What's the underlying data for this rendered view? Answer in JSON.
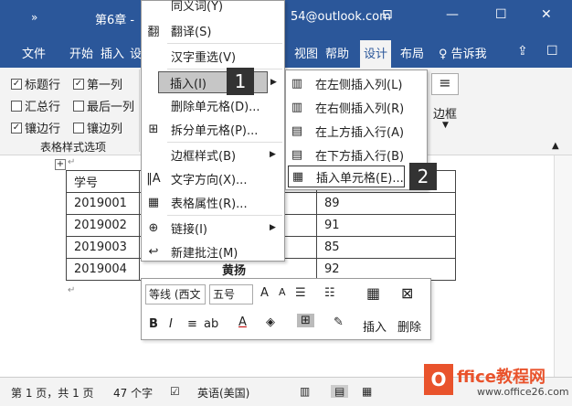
{
  "titlebar": {
    "quick_access": "»",
    "doc_title": "第6章 -",
    "account": "54@outlook.com",
    "restore_icon": "⊡",
    "minimize": "—",
    "maximize": "☐",
    "close": "✕"
  },
  "tabs": [
    "文件",
    "开始",
    "插入",
    "设",
    "视图",
    "帮助",
    "设计",
    "布局"
  ],
  "tell_me": "告诉我",
  "ribbon": {
    "options": [
      {
        "label": "标题行",
        "checked": true
      },
      {
        "label": "第一列",
        "checked": true
      },
      {
        "label": "汇总行",
        "checked": false
      },
      {
        "label": "最后一列",
        "checked": false
      },
      {
        "label": "镶边行",
        "checked": true
      },
      {
        "label": "镶边列",
        "checked": false
      }
    ],
    "group_label": "表格样式选项",
    "border_label": "边框"
  },
  "table": {
    "rows": [
      [
        "学号",
        "",
        ""
      ],
      [
        "2019001",
        "",
        "89"
      ],
      [
        "2019002",
        "",
        "91"
      ],
      [
        "2019003",
        "",
        "85"
      ],
      [
        "2019004",
        "黄扬",
        "92"
      ]
    ]
  },
  "context_menu": {
    "items": [
      {
        "icon": "",
        "label": "同义词(Y)"
      },
      {
        "icon": "翻",
        "label": "翻译(S)"
      },
      {
        "icon": "",
        "label": "汉字重选(V)"
      },
      {
        "icon": "",
        "label": "插入(I)"
      },
      {
        "icon": "",
        "label": "删除单元格(D)..."
      },
      {
        "icon": "⊞",
        "label": "拆分单元格(P)..."
      },
      {
        "icon": "",
        "label": "边框样式(B)"
      },
      {
        "icon": "‖A",
        "label": "文字方向(X)..."
      },
      {
        "icon": "▦",
        "label": "表格属性(R)..."
      },
      {
        "icon": "⊕",
        "label": "链接(I)"
      },
      {
        "icon": "↩",
        "label": "新建批注(M)"
      }
    ]
  },
  "submenu": {
    "items": [
      {
        "icon": "▥",
        "label": "在左侧插入列(L)"
      },
      {
        "icon": "▥",
        "label": "在右侧插入列(R)"
      },
      {
        "icon": "▤",
        "label": "在上方插入行(A)"
      },
      {
        "icon": "▤",
        "label": "在下方插入行(B)"
      },
      {
        "icon": "▦",
        "label": "插入单元格(E)..."
      }
    ]
  },
  "badges": [
    "1",
    "2"
  ],
  "mini_toolbar": {
    "font": "等线 (西文",
    "size": "五号",
    "grow": "A",
    "shrink": "A",
    "bold": "B",
    "italic": "I",
    "align": "≡",
    "insert": "插入",
    "delete": "删除"
  },
  "status": {
    "page": "第 1 页，共 1 页",
    "words": "47 个字",
    "lang": "英语(美国)"
  },
  "watermark": {
    "logo": "O",
    "text": "ffice教程网",
    "url": "www.office26.com"
  }
}
